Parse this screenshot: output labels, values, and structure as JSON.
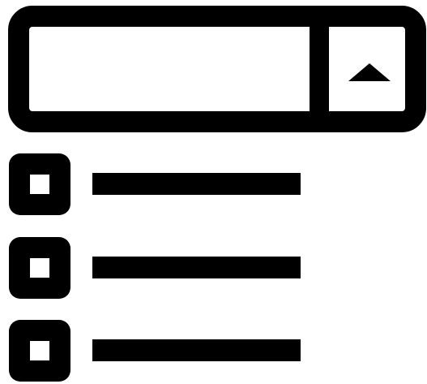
{
  "dropdown": {
    "selected_value": "",
    "toggle_icon": "triangle-up-icon",
    "expanded": true
  },
  "options": [
    {
      "label": "",
      "checked": false,
      "checkbox_icon": "checkbox-icon"
    },
    {
      "label": "",
      "checked": false,
      "checkbox_icon": "checkbox-icon"
    },
    {
      "label": "",
      "checked": false,
      "checkbox_icon": "checkbox-icon"
    }
  ],
  "colors": {
    "foreground": "#000000",
    "background": "#ffffff"
  }
}
